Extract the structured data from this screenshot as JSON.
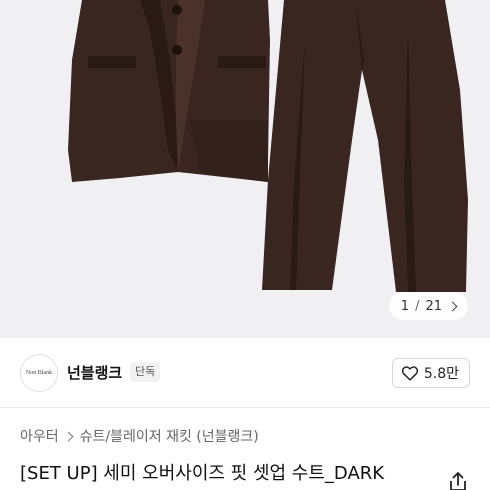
{
  "image_viewer": {
    "current": "1",
    "separator": "/",
    "total": "21"
  },
  "brand": {
    "logo_text": "Non Blank",
    "name": "넌블랭크",
    "badge": "단독"
  },
  "like": {
    "count": "5.8만"
  },
  "breadcrumb": {
    "items": [
      "아우터",
      "슈트/블레이저 재킷 (넌블랭크)"
    ]
  },
  "product": {
    "title": "[SET UP] 세미 오버사이즈 핏 셋업 수트_DARK"
  },
  "colors": {
    "image_bg": "#f0f0f2",
    "suit": "#3a2620",
    "suit_shadow": "#2a1a15"
  },
  "icons": {
    "like": "heart-icon",
    "share": "share-icon",
    "next_image": "chevron-right-icon",
    "breadcrumb_separator": "chevron-right-icon"
  }
}
